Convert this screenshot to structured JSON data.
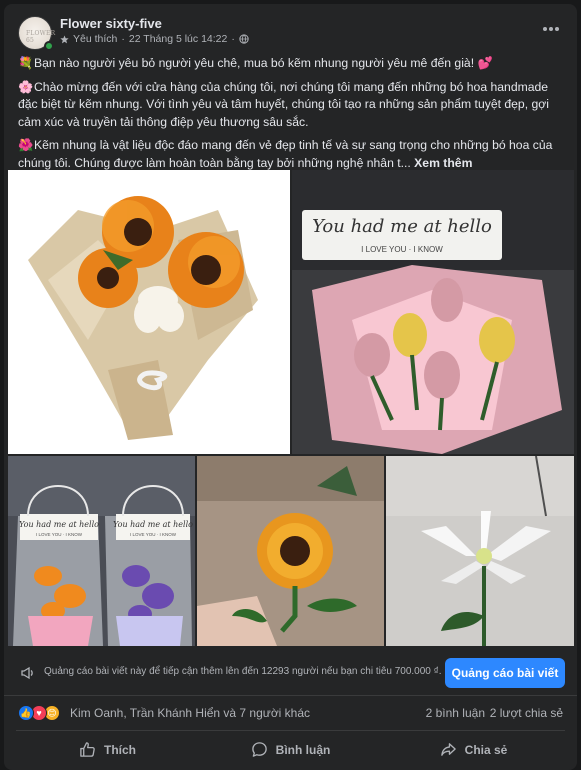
{
  "post": {
    "page_name": "Flower sixty-five",
    "avatar_text": "FLOWER 65",
    "meta_label": "Yêu thích",
    "separator": "·",
    "timestamp": "22 Tháng 5 lúc 14:22",
    "separator2": "·",
    "paragraphs": [
      {
        "emoji": "💐",
        "text": "Bạn nào người yêu bỏ người yêu chê, mua bó kẽm nhung người yêu mê đến già! 💕"
      },
      {
        "emoji": "🌸",
        "text": "Chào mừng đến với cửa hàng của chúng tôi, nơi chúng tôi mang đến những bó hoa handmade đặc biệt từ kẽm nhung. Với tình yêu và tâm huyết, chúng tôi tạo ra những sản phẩm tuyệt đẹp, gợi cảm xúc và truyền tải thông điệp yêu thương sâu sắc."
      },
      {
        "emoji": "🌺",
        "text": "Kẽm nhung là vật liệu độc đáo mang đến vẻ đẹp tinh tế và sự sang trọng cho những bó hoa của chúng tôi. Chúng được làm hoàn toàn bằng tay bởi những nghệ nhân t... "
      }
    ],
    "see_more": "Xem thêm"
  },
  "photos": {
    "card_line1": "You had me at hello",
    "card_line2": "I LOVE YOU · I KNOW",
    "small_card_line1": "You had me at hello",
    "small_card_line2": "I LOVE YOU · I KNOW"
  },
  "promo": {
    "text": "Quảng cáo bài viết này để tiếp cận thêm lên đến 12293 người nếu bạn chi tiêu 700.000 ₫.",
    "button": "Quảng cáo bài viết"
  },
  "stats": {
    "reaction_names": "Kim Oanh, Trần Khánh Hiển và 7 người khác",
    "comments": "2 bình luận",
    "shares": "2 lượt chia sẻ"
  },
  "actions": {
    "like": "Thích",
    "comment": "Bình luận",
    "share": "Chia sẻ"
  },
  "colors": {
    "background": "#18191a",
    "card": "#242526",
    "accent": "#2d88ff",
    "text_primary": "#e4e6eb",
    "text_secondary": "#b0b3b8"
  }
}
